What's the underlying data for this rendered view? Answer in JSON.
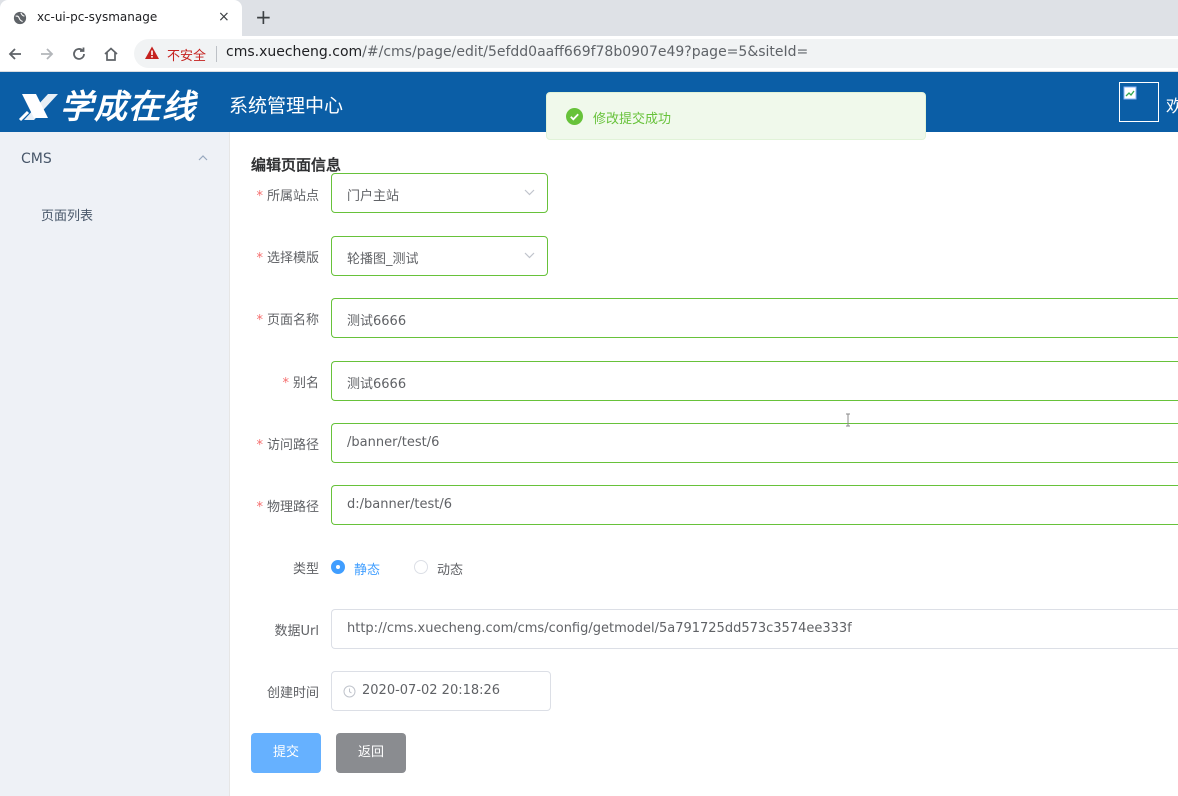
{
  "browser": {
    "tab_title": "xc-ui-pc-sysmanage",
    "tab_close": "×",
    "new_tab": "+",
    "insecure_label": "不安全",
    "url_host": "cms.xuecheng.com",
    "url_path": "/#/cms/page/edit/5efdd0aaff669f78b0907e49?page=5&siteId="
  },
  "header": {
    "logo_text": "学成在线",
    "subtitle": "系统管理中心",
    "welcome": "欢"
  },
  "sidebar": {
    "menu_title": "CMS",
    "items": [
      {
        "label": "页面列表"
      }
    ]
  },
  "form": {
    "heading": "编辑页面信息",
    "required_mark": "*",
    "site": {
      "label": "所属站点",
      "value": "门户主站"
    },
    "template": {
      "label": "选择模版",
      "value": "轮播图_测试"
    },
    "page_name": {
      "label": "页面名称",
      "value": "测试6666"
    },
    "alias": {
      "label": "别名",
      "value": "测试6666"
    },
    "web_path": {
      "label": "访问路径",
      "value": "/banner/test/6"
    },
    "physical_path": {
      "label": "物理路径",
      "value": "d:/banner/test/6"
    },
    "type": {
      "label": "类型",
      "options": [
        {
          "label": "静态",
          "selected": true
        },
        {
          "label": "动态",
          "selected": false
        }
      ]
    },
    "data_url": {
      "label": "数据Url",
      "value": "http://cms.xuecheng.com/cms/config/getmodel/5a791725dd573c3574ee333f"
    },
    "create_time": {
      "label": "创建时间",
      "value": "2020-07-02 20:18:26"
    },
    "submit_label": "提交",
    "back_label": "返回"
  },
  "toast": {
    "message": "修改提交成功",
    "icon": "success-check-icon"
  },
  "colors": {
    "header_bg": "#0b5ea6",
    "sidebar_bg": "#eef1f6",
    "valid_border": "#67c23a",
    "primary": "#409eff",
    "submit_bg": "#66b1ff",
    "back_bg": "#8a8c90",
    "required": "#f56c6c",
    "toast_bg": "#f0f9eb"
  }
}
